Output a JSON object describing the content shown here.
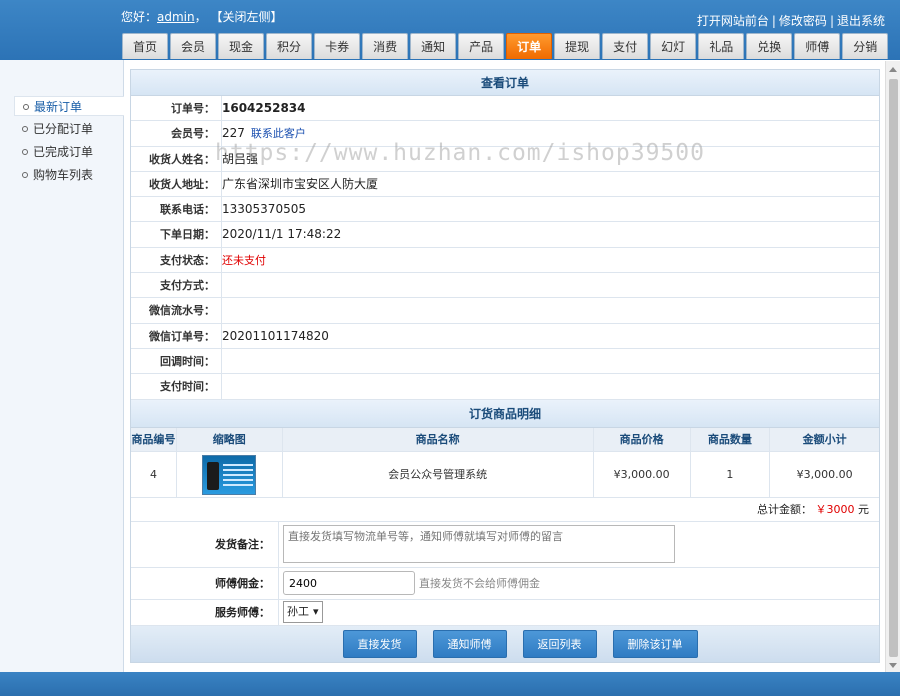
{
  "header": {
    "greeting": "您好：",
    "username": "admin",
    "comma": "，",
    "close_left": "【关闭左侧】",
    "links": [
      "打开网站前台",
      "修改密码",
      "退出系统"
    ]
  },
  "tabs": [
    {
      "label": "首页"
    },
    {
      "label": "会员"
    },
    {
      "label": "现金"
    },
    {
      "label": "积分"
    },
    {
      "label": "卡券"
    },
    {
      "label": "消费"
    },
    {
      "label": "通知"
    },
    {
      "label": "产品"
    },
    {
      "label": "订单"
    },
    {
      "label": "提现"
    },
    {
      "label": "支付"
    },
    {
      "label": "幻灯"
    },
    {
      "label": "礼品"
    },
    {
      "label": "兑换"
    },
    {
      "label": "师傅"
    },
    {
      "label": "分销"
    }
  ],
  "active_tab": "订单",
  "sidebar": {
    "items": [
      {
        "label": "最新订单"
      },
      {
        "label": "已分配订单"
      },
      {
        "label": "已完成订单"
      },
      {
        "label": "购物车列表"
      }
    ]
  },
  "order": {
    "title": "查看订单",
    "fields": {
      "order_no_label": "订单号：",
      "order_no": "1604252834",
      "member_label": "会员号：",
      "member": "227",
      "contact_link": "联系此客户",
      "name_label": "收货人姓名：",
      "name": "胡吕强",
      "address_label": "收货人地址：",
      "address": "广东省深圳市宝安区人防大厦",
      "phone_label": "联系电话：",
      "phone": "13305370505",
      "date_label": "下单日期：",
      "date": "2020/11/1 17:48:22",
      "pay_status_label": "支付状态：",
      "pay_status": "还未支付",
      "pay_method_label": "支付方式：",
      "pay_method": "",
      "wx_flow_label": "微信流水号：",
      "wx_flow": "",
      "wx_order_label": "微信订单号：",
      "wx_order": "20201101174820",
      "callback_label": "回调时间：",
      "callback": "",
      "pay_time_label": "支付时间：",
      "pay_time": ""
    }
  },
  "goods": {
    "title": "订货商品明细",
    "headers": [
      "商品编号",
      "缩略图",
      "商品名称",
      "商品价格",
      "商品数量",
      "金额小计"
    ],
    "rows": [
      {
        "id": "4",
        "name": "会员公众号管理系统",
        "price": "¥3,000.00",
        "qty": "1",
        "subtotal": "¥3,000.00"
      }
    ],
    "total_label": "总计金额：",
    "total_amount": "￥3000",
    "total_unit": "元"
  },
  "form": {
    "remark_label": "发货备注：",
    "remark_placeholder": "直接发货填写物流单号等，通知师傅就填写对师傅的留言",
    "commission_label": "师傅佣金：",
    "commission_value": "2400",
    "commission_hint": "直接发货不会给师傅佣金",
    "master_label": "服务师傅：",
    "master_selected": "孙工"
  },
  "buttons": {
    "ship": "直接发货",
    "notify": "通知师傅",
    "back": "返回列表",
    "delete": "删除该订单"
  },
  "watermark": "https://www.huzhan.com/ishop39500"
}
